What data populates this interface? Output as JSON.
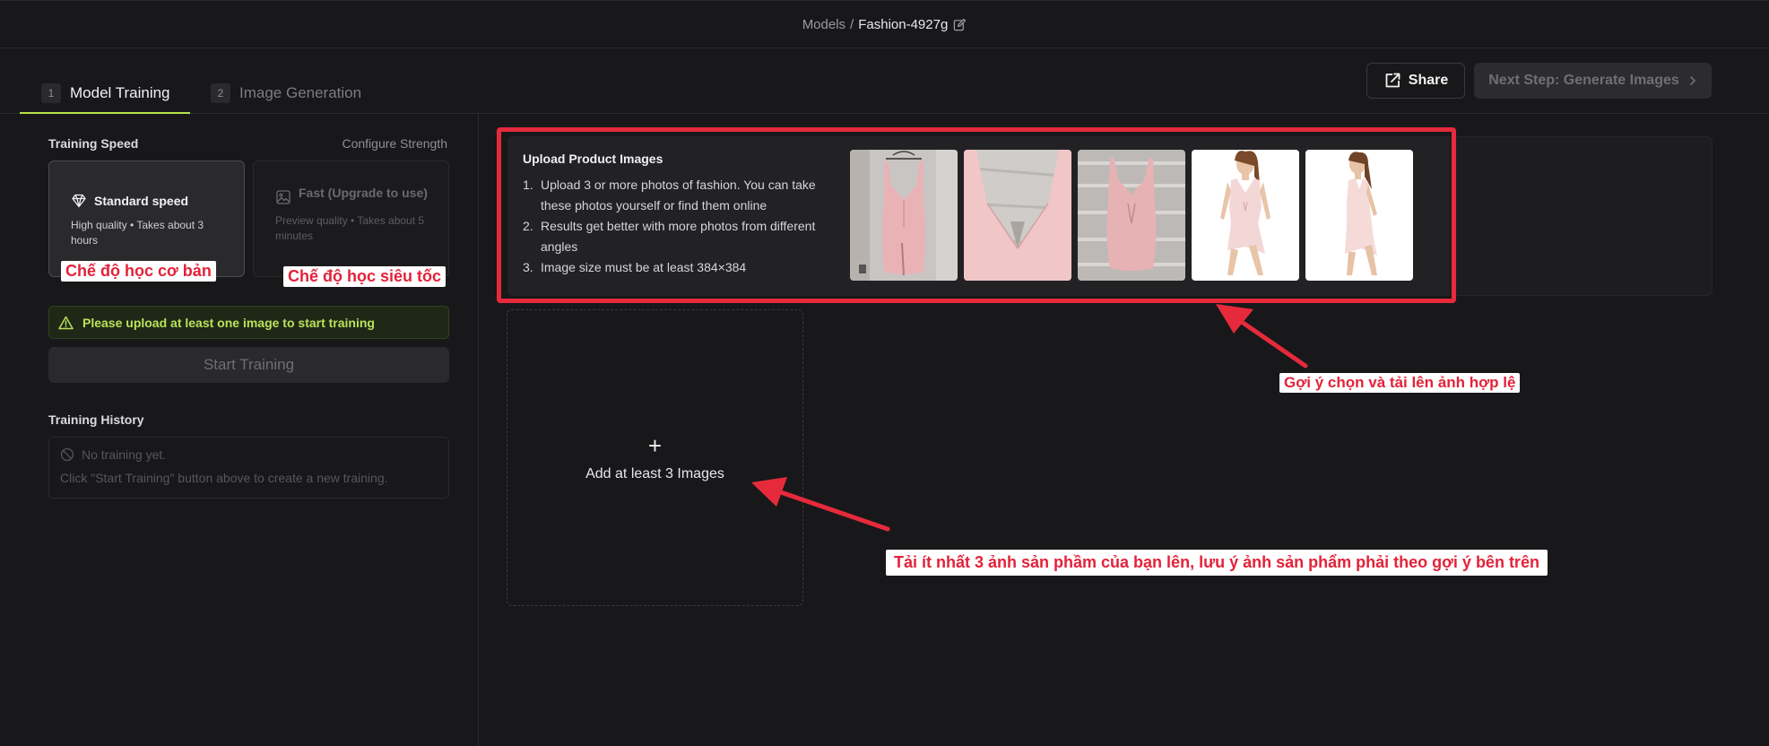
{
  "breadcrumb": {
    "root": "Models",
    "separator": "/",
    "current": "Fashion-4927g"
  },
  "tabs": [
    {
      "num": "1",
      "label": "Model Training"
    },
    {
      "num": "2",
      "label": "Image Generation"
    }
  ],
  "header_actions": {
    "share_label": "Share",
    "next_label": "Next Step: Generate Images"
  },
  "training": {
    "speed_label": "Training Speed",
    "configure_label": "Configure Strength",
    "standard": {
      "title": "Standard speed",
      "desc": "High quality • Takes about 3 hours"
    },
    "fast": {
      "title": "Fast (Upgrade to use)",
      "desc": "Preview quality • Takes about 5 minutes"
    },
    "warning": "Please upload at least one image to start training",
    "start_label": "Start Training",
    "history_label": "Training History",
    "history_empty": "No training yet.",
    "history_hint": "Click \"Start Training\" button above to create a new training."
  },
  "upload": {
    "title": "Upload Product Images",
    "tips": [
      {
        "idx": "1.",
        "text": "Upload 3 or more photos of fashion. You can take these photos yourself or find them online"
      },
      {
        "idx": "2.",
        "text": "Results get better with more photos from different angles"
      },
      {
        "idx": "3.",
        "text": "Image size must be at least 384×384"
      }
    ],
    "add_label": "Add at least 3 Images"
  },
  "annotations": {
    "basic_mode": "Chế độ học cơ bản",
    "fast_mode": "Chế độ học siêu tốc",
    "hint_upload": "Gợi ý chọn và tải lên ảnh hợp lệ",
    "upload_note": "Tải ít nhất 3 ảnh sản phầm của bạn lên, lưu ý ảnh sản phẩm phải theo gợi ý bên trên"
  },
  "colors": {
    "accent": "#b5e34a",
    "annotation_red": "#e62a3c",
    "background": "#18181a"
  }
}
